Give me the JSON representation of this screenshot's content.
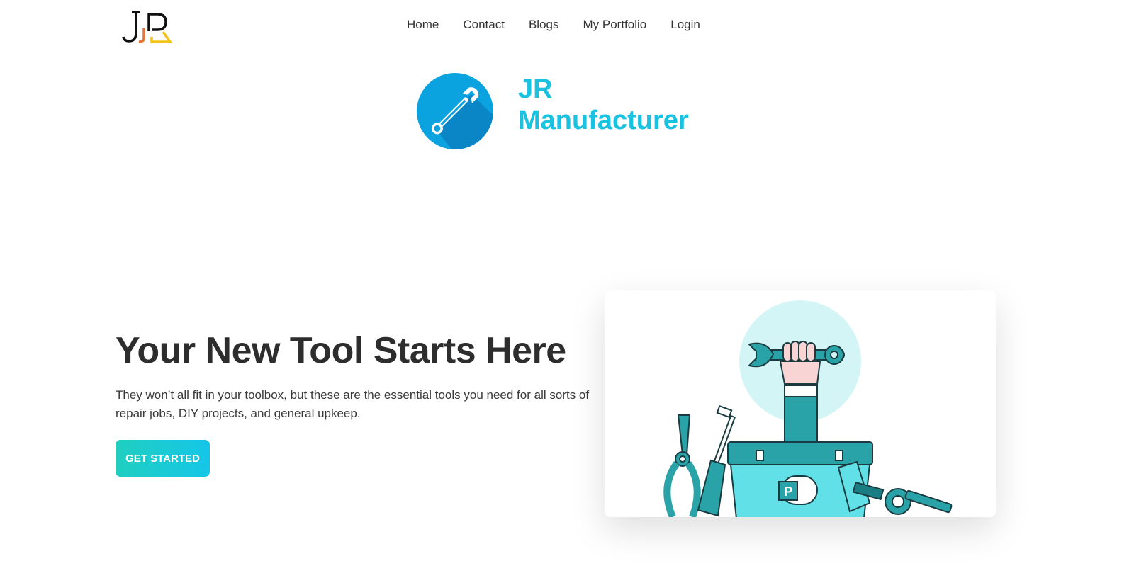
{
  "header": {
    "logo_text": "JR",
    "nav": [
      {
        "label": "Home"
      },
      {
        "label": "Contact"
      },
      {
        "label": "Blogs"
      },
      {
        "label": "My Portfolio"
      },
      {
        "label": "Login"
      }
    ]
  },
  "brand": {
    "line1": "JR",
    "line2": "Manufacturer",
    "icon": "wrench-icon",
    "color": "#19c2e0"
  },
  "hero": {
    "title": "Your New Tool Starts Here",
    "description": "They won’t all fit in your toolbox, but these are the essential tools you need for all sorts of repair jobs, DIY projects, and general upkeep.",
    "cta_label": "GET STARTED",
    "illustration": "toolbox-illustration",
    "toolbox_label": "P"
  },
  "colors": {
    "accent": "#19c2e0",
    "teal": "#2ab5b8",
    "text_dark": "#2d2d2d"
  }
}
